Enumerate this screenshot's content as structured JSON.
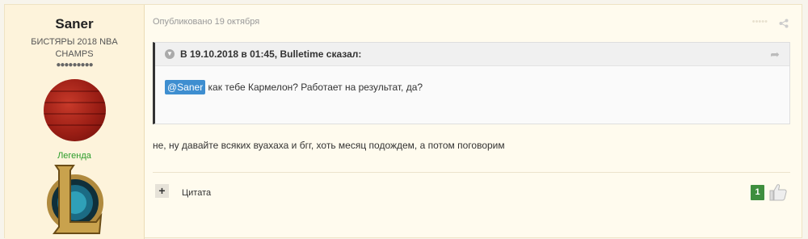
{
  "author": {
    "name": "Saner",
    "title": "БИСТЯРЫ 2018 NBA CHAMPS",
    "rank_dots": "●●●●●●●●●",
    "group": "Легенда"
  },
  "post": {
    "published": "Опубликовано 19 октября",
    "quote": {
      "citation": "В 19.10.2018 в 01:45, Bulletime сказал:",
      "mention": "@Saner",
      "text": " как тебе Кармелон? Работает на результат, да?"
    },
    "text": "не, ну давайте всяких вуахаха и бгг, хоть месяц подождем, а потом поговорим",
    "quote_button_label": "Цитата",
    "reputation": "1"
  },
  "colors": {
    "group": "#2a9c2a",
    "mention_bg": "#3e8ed0",
    "reputation_bg": "#3e8e3e"
  }
}
